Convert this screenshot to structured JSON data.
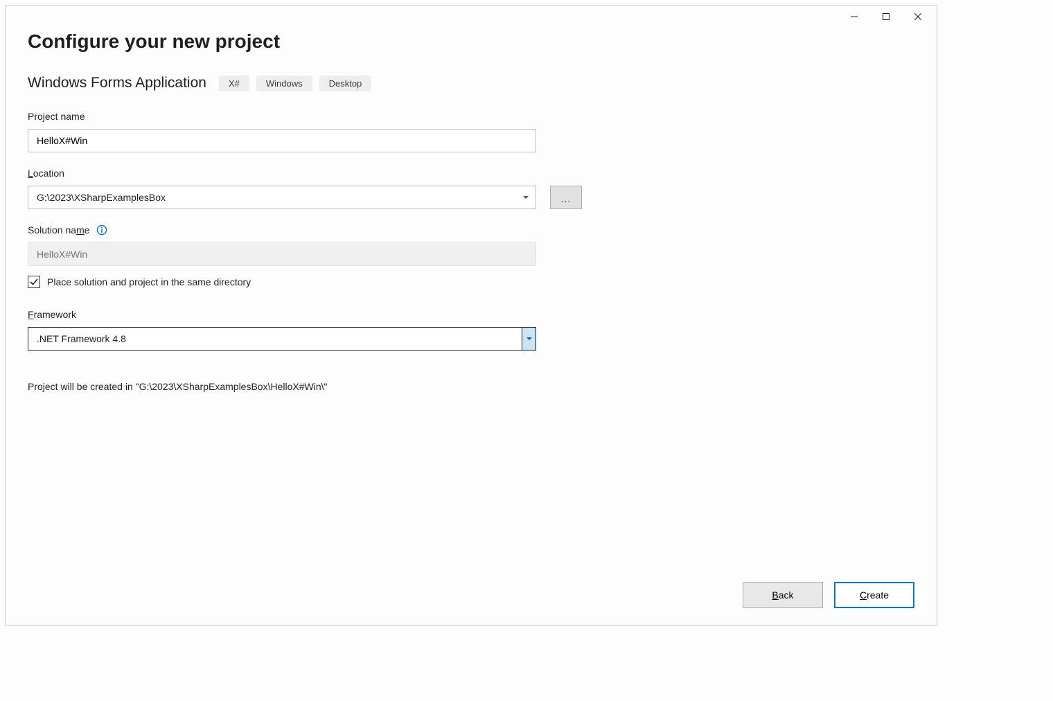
{
  "header": {
    "title": "Configure your new project"
  },
  "template": {
    "name": "Windows Forms Application",
    "tags": [
      "X#",
      "Windows",
      "Desktop"
    ]
  },
  "fields": {
    "project_name": {
      "label": "Project name",
      "value": "HelloX#Win"
    },
    "location": {
      "label_prefix": "",
      "label_underline": "L",
      "label_suffix": "ocation",
      "value": "G:\\2023\\XSharpExamplesBox"
    },
    "browse": {
      "label": "..."
    },
    "solution_name": {
      "label_prefix": "Solution na",
      "label_underline": "m",
      "label_suffix": "e",
      "placeholder": "HelloX#Win"
    },
    "same_dir": {
      "label_prefix": "Place solution and project in the same ",
      "label_underline": "d",
      "label_suffix": "irectory",
      "checked": true
    },
    "framework": {
      "label_prefix": "",
      "label_underline": "F",
      "label_suffix": "ramework",
      "value": ".NET Framework 4.8"
    }
  },
  "status": "Project will be created in \"G:\\2023\\XSharpExamplesBox\\HelloX#Win\\\"",
  "footer": {
    "back_prefix": "",
    "back_underline": "B",
    "back_suffix": "ack",
    "create_prefix": "",
    "create_underline": "C",
    "create_suffix": "reate"
  }
}
